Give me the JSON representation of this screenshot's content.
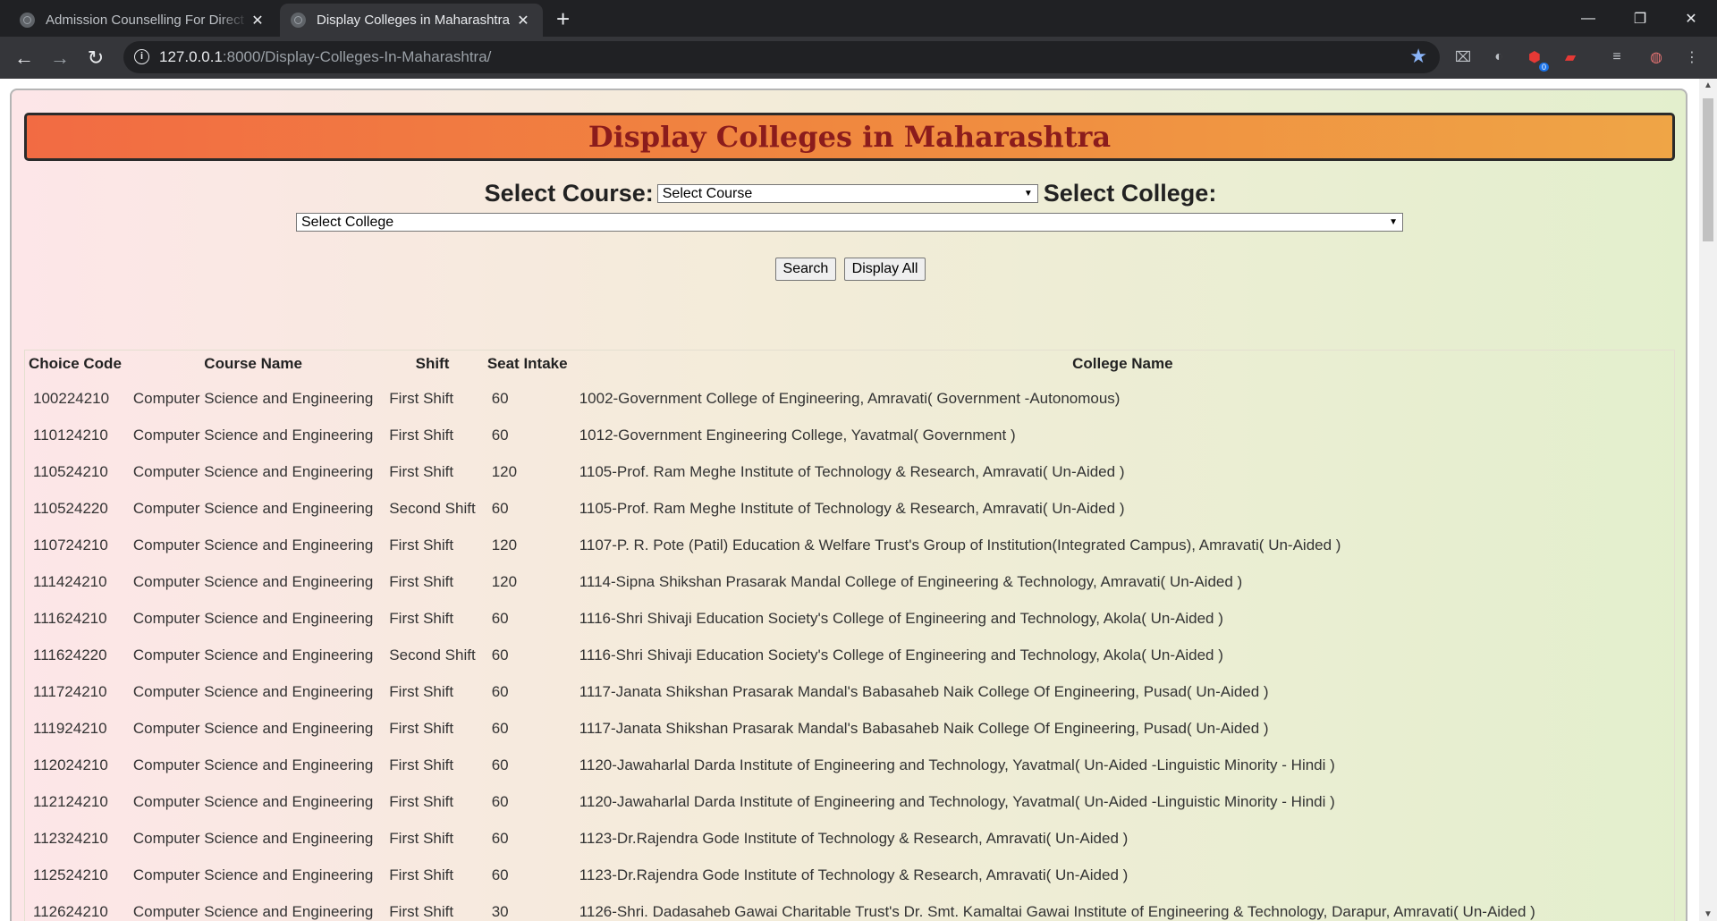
{
  "browser": {
    "tabs": [
      {
        "title": "Admission Counselling For Direct Second Year Engineering",
        "active": false
      },
      {
        "title": "Display Colleges in Maharashtra",
        "active": true
      }
    ],
    "url_host": "127.0.0.1",
    "url_rest": ":8000/Display-Colleges-In-Maharashtra/",
    "extension_badge": "0"
  },
  "page": {
    "heading": "Display Colleges in Maharashtra",
    "course_label": "Select Course:",
    "course_selected": "Select Course",
    "college_label": "Select College:",
    "college_selected": "Select College",
    "search_button": "Search",
    "display_all_button": "Display All"
  },
  "table": {
    "headers": [
      "Choice Code",
      "Course Name",
      "Shift",
      "Seat Intake",
      "College Name"
    ],
    "rows": [
      [
        "100224210",
        "Computer Science and Engineering",
        "First Shift",
        "60",
        "1002-Government College of Engineering, Amravati( Government -Autonomous)"
      ],
      [
        "110124210",
        "Computer Science and Engineering",
        "First Shift",
        "60",
        "1012-Government Engineering College, Yavatmal( Government )"
      ],
      [
        "110524210",
        "Computer Science and Engineering",
        "First Shift",
        "120",
        "1105-Prof. Ram Meghe Institute of Technology & Research, Amravati( Un-Aided )"
      ],
      [
        "110524220",
        "Computer Science and Engineering",
        "Second Shift",
        "60",
        "1105-Prof. Ram Meghe Institute of Technology & Research, Amravati( Un-Aided )"
      ],
      [
        "110724210",
        "Computer Science and Engineering",
        "First Shift",
        "120",
        "1107-P. R. Pote (Patil) Education & Welfare Trust's Group of Institution(Integrated Campus), Amravati( Un-Aided )"
      ],
      [
        "111424210",
        "Computer Science and Engineering",
        "First Shift",
        "120",
        "1114-Sipna Shikshan Prasarak Mandal College of Engineering & Technology, Amravati( Un-Aided )"
      ],
      [
        "111624210",
        "Computer Science and Engineering",
        "First Shift",
        "60",
        "1116-Shri Shivaji Education Society's College of Engineering and Technology, Akola( Un-Aided )"
      ],
      [
        "111624220",
        "Computer Science and Engineering",
        "Second Shift",
        "60",
        "1116-Shri Shivaji Education Society's College of Engineering and Technology, Akola( Un-Aided )"
      ],
      [
        "111724210",
        "Computer Science and Engineering",
        "First Shift",
        "60",
        "1117-Janata Shikshan Prasarak Mandal's Babasaheb Naik College Of Engineering, Pusad( Un-Aided )"
      ],
      [
        "111924210",
        "Computer Science and Engineering",
        "First Shift",
        "60",
        "1117-Janata Shikshan Prasarak Mandal's Babasaheb Naik College Of Engineering, Pusad( Un-Aided )"
      ],
      [
        "112024210",
        "Computer Science and Engineering",
        "First Shift",
        "60",
        "1120-Jawaharlal Darda Institute of Engineering and Technology, Yavatmal( Un-Aided -Linguistic Minority - Hindi )"
      ],
      [
        "112124210",
        "Computer Science and Engineering",
        "First Shift",
        "60",
        "1120-Jawaharlal Darda Institute of Engineering and Technology, Yavatmal( Un-Aided -Linguistic Minority - Hindi )"
      ],
      [
        "112324210",
        "Computer Science and Engineering",
        "First Shift",
        "60",
        "1123-Dr.Rajendra Gode Institute of Technology & Research, Amravati( Un-Aided )"
      ],
      [
        "112524210",
        "Computer Science and Engineering",
        "First Shift",
        "60",
        "1123-Dr.Rajendra Gode Institute of Technology & Research, Amravati( Un-Aided )"
      ],
      [
        "112624210",
        "Computer Science and Engineering",
        "First Shift",
        "30",
        "1126-Shri. Dadasaheb Gawai Charitable Trust's Dr. Smt. Kamaltai Gawai Institute of Engineering & Technology, Darapur, Amravati( Un-Aided )"
      ]
    ]
  }
}
